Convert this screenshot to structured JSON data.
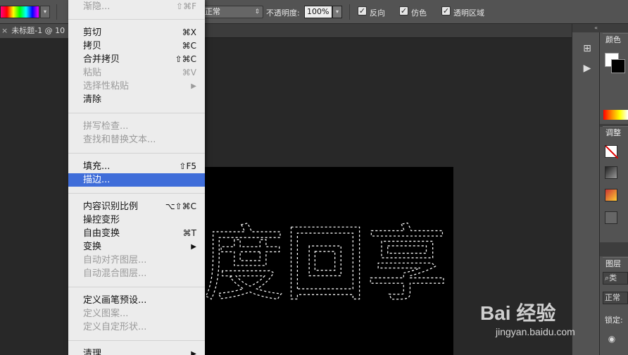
{
  "options_bar": {
    "mode_value": "正常",
    "opacity_label": "不透明度:",
    "opacity_value": "100%",
    "checkbox_reverse": "反向",
    "checkbox_dither": "仿色",
    "checkbox_transparency": "透明区域"
  },
  "document_tab": {
    "close": "×",
    "title": "未标题-1 @ 10"
  },
  "menu": {
    "items": [
      {
        "label": "渐隐...",
        "shortcut": "⇧⌘F",
        "disabled": true
      },
      {
        "label": "剪切",
        "shortcut": "⌘X"
      },
      {
        "label": "拷贝",
        "shortcut": "⌘C"
      },
      {
        "label": "合并拷贝",
        "shortcut": "⇧⌘C"
      },
      {
        "label": "粘贴",
        "shortcut": "⌘V",
        "disabled": true
      },
      {
        "label": "选择性粘贴",
        "submenu": "▶",
        "disabled": true
      },
      {
        "label": "清除"
      },
      {
        "label": "拼写检查...",
        "disabled": true
      },
      {
        "label": "查找和替换文本...",
        "disabled": true
      },
      {
        "label": "填充...",
        "shortcut": "⇧F5"
      },
      {
        "label": "描边...",
        "highlighted": true
      },
      {
        "label": "内容识别比例",
        "shortcut": "⌥⇧⌘C"
      },
      {
        "label": "操控变形"
      },
      {
        "label": "自由变换",
        "shortcut": "⌘T"
      },
      {
        "label": "变换",
        "submenu": "▶"
      },
      {
        "label": "自动对齐图层...",
        "disabled": true
      },
      {
        "label": "自动混合图层...",
        "disabled": true
      },
      {
        "label": "定义画笔预设..."
      },
      {
        "label": "定义图案...",
        "disabled": true
      },
      {
        "label": "定义自定形状...",
        "disabled": true
      },
      {
        "label": "清理",
        "submenu": "▶"
      }
    ]
  },
  "canvas": {
    "selection_text": "度回享"
  },
  "panels": {
    "color_tab": "颜色",
    "adjust_tab": "调整",
    "layers_tab": "图层",
    "layer_kind": "类",
    "blend_mode": "正常",
    "lock_label": "锁定:"
  },
  "watermark": {
    "brand": "Bai 经验",
    "url": "jingyan.baidu.com"
  },
  "colors": {
    "menu_highlight": "#3f6dd9",
    "menu_bg": "#ececec",
    "panel_bg": "#535353"
  }
}
